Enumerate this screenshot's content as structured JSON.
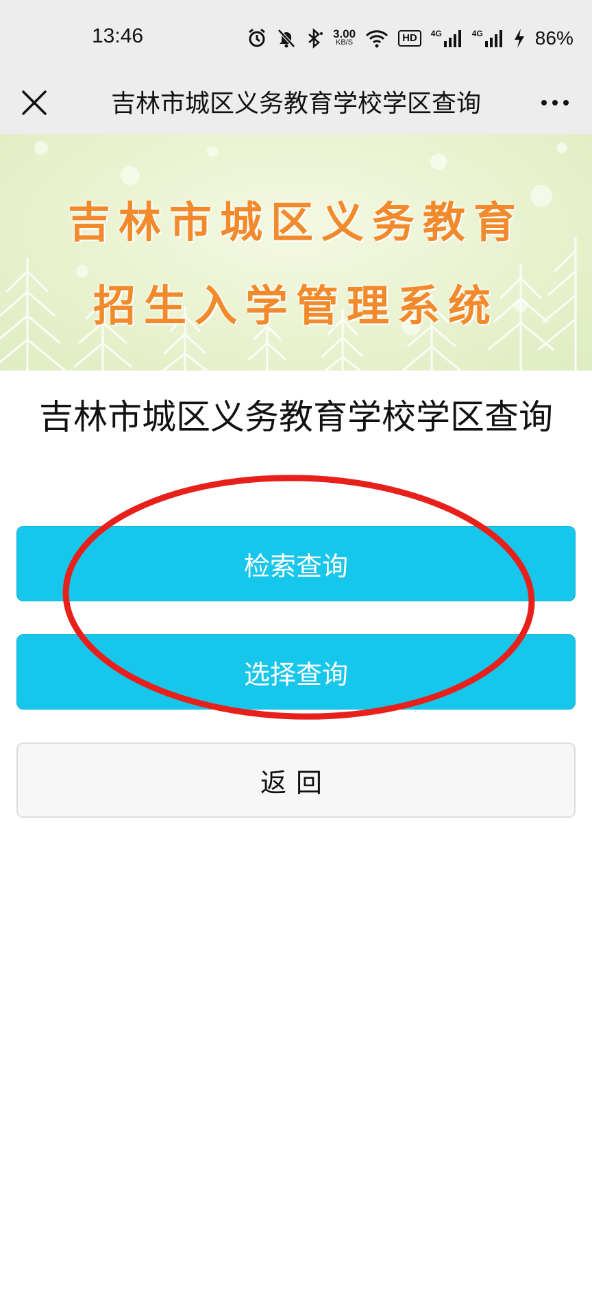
{
  "status_bar": {
    "time": "13:46",
    "net_speed_value": "3.00",
    "net_speed_unit": "KB/S",
    "hd_label": "HD",
    "net1_label": "4G",
    "net2_label": "4G",
    "battery": "86%",
    "icons": [
      "alarm-icon",
      "mute-icon",
      "bluetooth-icon",
      "wifi-icon",
      "hd-icon",
      "signal-icon",
      "signal-icon",
      "charging-icon"
    ]
  },
  "title_bar": {
    "title": "吉林市城区义务教育学校学区查询"
  },
  "banner": {
    "line1": "吉林市城区义务教育",
    "line2": "招生入学管理系统"
  },
  "main": {
    "heading": "吉林市城区义务教育学校学区查询",
    "buttons": {
      "search": "检索查询",
      "select": "选择查询",
      "back": "返回"
    }
  },
  "colors": {
    "primary_button": "#17c6eb",
    "banner_text": "#f08a2c",
    "annotation": "#e8201c",
    "bar_bg": "#ededed"
  }
}
